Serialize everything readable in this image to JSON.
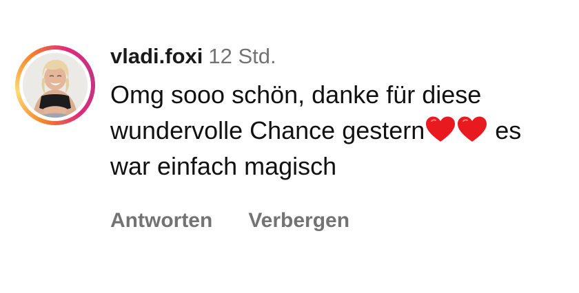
{
  "comment": {
    "username": "vladi.foxi",
    "time": "12 Std.",
    "text_part1": "Omg sooo schön, danke für diese wundervolle Chance gestern",
    "hearts": "❤️❤️",
    "text_part2": " es war einfach magisch",
    "heart_icon": "red-heart-emoji",
    "heart_color": "#e8191f"
  },
  "actions": {
    "reply_label": "Antworten",
    "hide_label": "Verbergen"
  },
  "colors": {
    "secondary_text": "#737373",
    "ring_gradient": [
      "#f58529",
      "#feda77",
      "#dd2a7b",
      "#c13584"
    ]
  }
}
